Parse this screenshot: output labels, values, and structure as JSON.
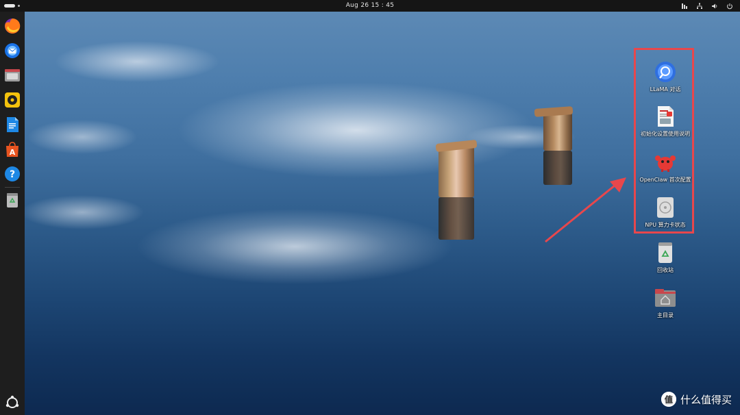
{
  "topbar": {
    "clock": "Aug 26  15 : 45",
    "tray_icons": [
      "accessibility-icon",
      "network-icon",
      "volume-icon",
      "power-icon"
    ]
  },
  "dock": {
    "items": [
      {
        "name": "firefox-icon"
      },
      {
        "name": "thunderbird-icon"
      },
      {
        "name": "files-icon"
      },
      {
        "name": "rhythmbox-icon"
      },
      {
        "name": "writer-icon"
      },
      {
        "name": "app-center-icon"
      },
      {
        "name": "help-icon"
      },
      {
        "name": "trash-icon"
      }
    ],
    "show_apps": "show-apps-icon"
  },
  "desktop": {
    "highlighted_icons": [
      {
        "label": "LLaMA 对话",
        "icon": "llama-chat-icon"
      },
      {
        "label": "初始化设置使用说明",
        "icon": "document-icon"
      },
      {
        "label": "OpenClaw 首次配置",
        "icon": "openclaw-icon"
      },
      {
        "label": "NPU 算力卡状态",
        "icon": "disk-icon"
      }
    ],
    "icons": [
      {
        "label": "回收站",
        "icon": "trash-icon"
      },
      {
        "label": "主目录",
        "icon": "home-folder-icon"
      }
    ]
  },
  "watermark": {
    "text": "什么值得买",
    "logo_text": "值"
  },
  "colors": {
    "highlight": "#e8474c",
    "topbar": "#151515",
    "dock": "#1e1e1e"
  }
}
